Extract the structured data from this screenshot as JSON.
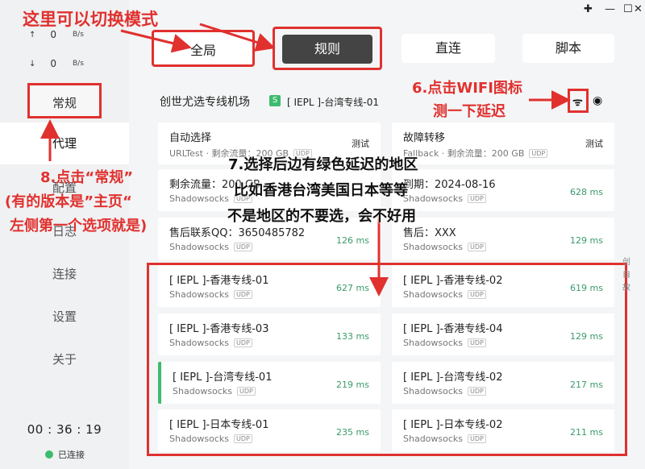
{
  "window": {
    "controls": [
      "✚",
      "—",
      "☐",
      "✕"
    ]
  },
  "traffic": {
    "upload": {
      "arrow": "↑",
      "value": "0",
      "unit": "B/s"
    },
    "download": {
      "arrow": "↓",
      "value": "0",
      "unit": "B/s"
    }
  },
  "sidebar": {
    "items": [
      {
        "label": "常规"
      },
      {
        "label": "代理"
      },
      {
        "label": "配置"
      },
      {
        "label": "日志"
      },
      {
        "label": "连接"
      },
      {
        "label": "设置"
      },
      {
        "label": "关于"
      }
    ],
    "timer": "00 : 36 : 19",
    "status": "已连接"
  },
  "modes": {
    "global": "全局",
    "rule": "规则",
    "direct": "直连",
    "script": "脚本"
  },
  "header": {
    "group_name": "创世尤选专线机场",
    "badge": "S",
    "current_node": "[ IEPL ]-台湾专线-01"
  },
  "cards": [
    {
      "name": "自动选择",
      "type": "URLTest · 剩余流量：200 GB",
      "udp": "UDP",
      "latency": "测试"
    },
    {
      "name": "故障转移",
      "type": "Fallback · 剩余流量：200 GB",
      "udp": "UDP",
      "latency": "测试"
    },
    {
      "name": "剩余流量：200 GB",
      "type": "Shadowsocks",
      "udp": "UDP",
      "latency": ""
    },
    {
      "name": "到期：2024-08-16",
      "type": "Shadowsocks",
      "udp": "UDP",
      "latency": "628 ms"
    },
    {
      "name": "售后联系QQ：3650485782",
      "type": "Shadowsocks",
      "udp": "UDP",
      "latency": "126 ms"
    },
    {
      "name": "售后：XXX",
      "type": "Shadowsocks",
      "udp": "UDP",
      "latency": "129 ms"
    },
    {
      "name": "[ IEPL ]-香港专线-01",
      "type": "Shadowsocks",
      "udp": "UDP",
      "latency": "627 ms"
    },
    {
      "name": "[ IEPL ]-香港专线-02",
      "type": "Shadowsocks",
      "udp": "UDP",
      "latency": "619 ms"
    },
    {
      "name": "[ IEPL ]-香港专线-03",
      "type": "Shadowsocks",
      "udp": "UDP",
      "latency": "133 ms"
    },
    {
      "name": "[ IEPL ]-香港专线-04",
      "type": "Shadowsocks",
      "udp": "UDP",
      "latency": "129 ms"
    },
    {
      "name": "[ IEPL ]-台湾专线-01",
      "type": "Shadowsocks",
      "udp": "UDP",
      "latency": "219 ms"
    },
    {
      "name": "[ IEPL ]-台湾专线-02",
      "type": "Shadowsocks",
      "udp": "UDP",
      "latency": "217 ms"
    },
    {
      "name": "[ IEPL ]-日本专线-01",
      "type": "Shadowsocks",
      "udp": "UDP",
      "latency": "235 ms"
    },
    {
      "name": "[ IEPL ]-日本专线-02",
      "type": "Shadowsocks",
      "udp": "UDP",
      "latency": "211 ms"
    }
  ],
  "side_text": "创自故",
  "annotations": {
    "switch_mode": "这里可以切换模式",
    "wifi_line1": "6.点击WIFI图标",
    "wifi_line2": "测一下延迟",
    "select_line1": "7.选择后边有绿色延迟的地区",
    "select_line2": "比如香港台湾美国日本等等",
    "select_line3": "不是地区的不要选，会不好用",
    "general_line1": "8.点击“常规”",
    "general_line2": "(有的版本是”主页“",
    "general_line3": "左侧第一个选项就是)"
  },
  "colors": {
    "accent_red": "#e0312f",
    "latency_green": "#3a9b6a",
    "status_green": "#3dbb6e",
    "active_mode": "#444444"
  }
}
